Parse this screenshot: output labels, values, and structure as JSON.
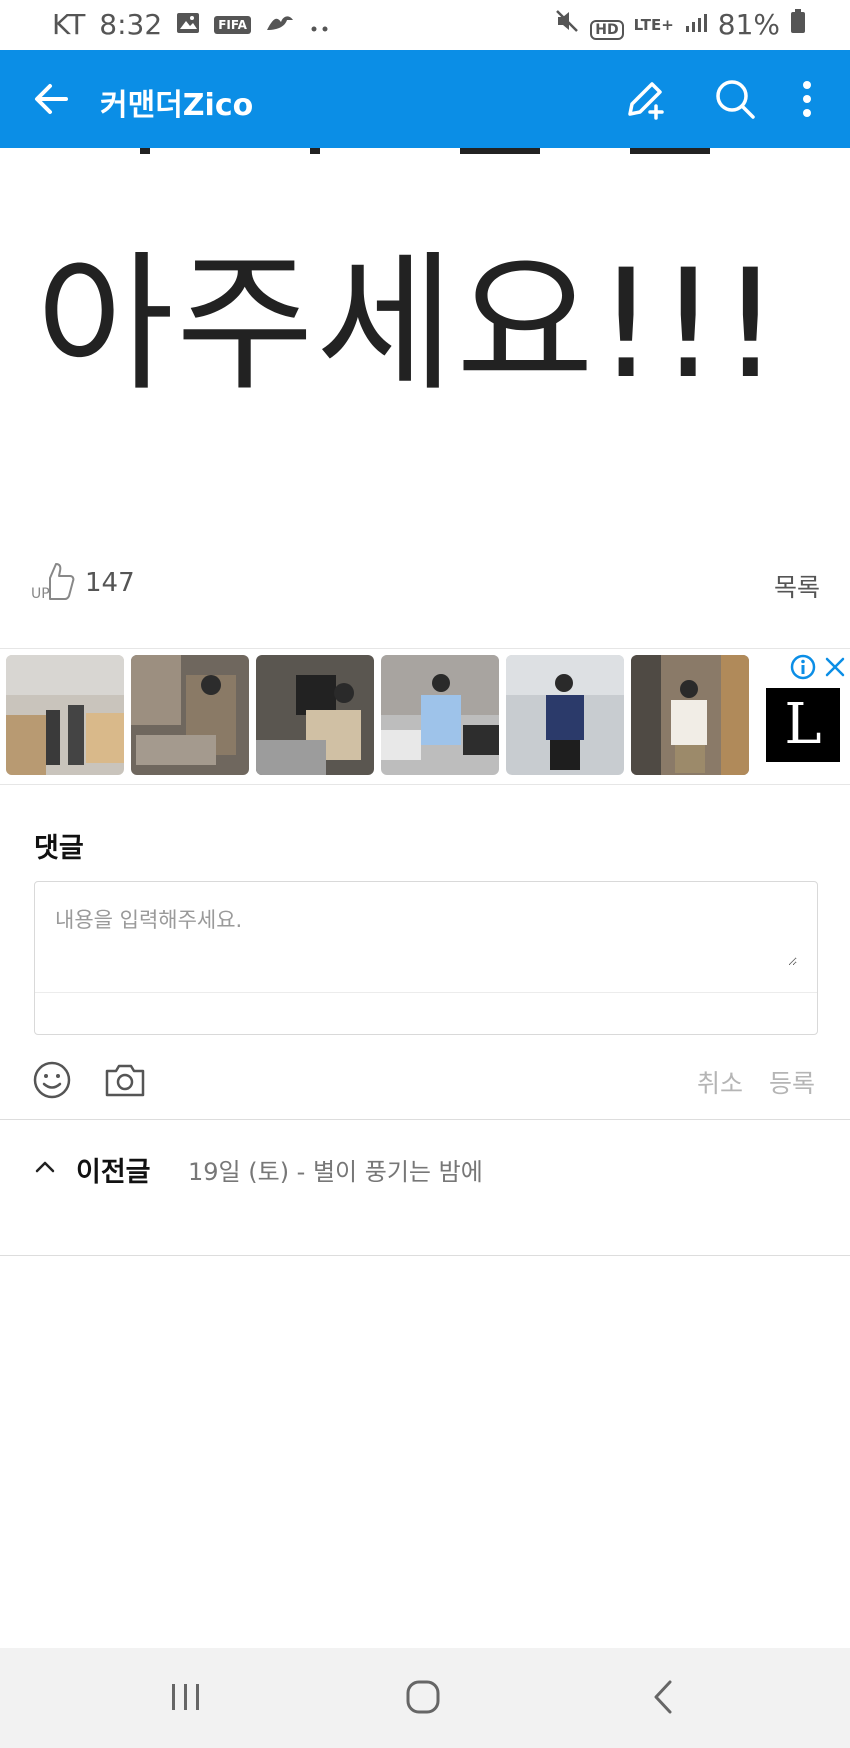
{
  "status_bar": {
    "carrier": "KT",
    "time": "8:32",
    "fifa_badge": "FIFA",
    "network": "LTE+",
    "hd_badge": "HD",
    "battery": "81%",
    "icons": [
      "gallery-icon",
      "fifa-icon",
      "game-icon",
      "more-dots-icon",
      "mute-icon",
      "hd-voice-icon",
      "lte-icon",
      "signal-icon",
      "battery-icon"
    ]
  },
  "app_bar": {
    "title": "커맨더Zico",
    "back_icon": "arrow-left-icon",
    "actions": [
      "write-icon",
      "search-icon",
      "more-vert-icon"
    ],
    "color": "#0b8ee6"
  },
  "article": {
    "big_text": "아주세요!!!"
  },
  "like": {
    "icon": "thumbs-up-icon",
    "count": "147",
    "list_label": "목록"
  },
  "ad": {
    "logo_text": "L",
    "icons": [
      "ad-info-icon",
      "ad-close-icon"
    ],
    "thumbnail_count": 6
  },
  "comments": {
    "title": "댓글",
    "placeholder": "내용을 입력해주세요.",
    "cancel_label": "취소",
    "submit_label": "등록",
    "tool_icons": [
      "emoji-icon",
      "camera-icon"
    ]
  },
  "previous_post": {
    "label": "이전글",
    "title": "19일 (토) - 별이 풍기는 밤에"
  },
  "nav_bar": {
    "buttons": [
      "recents-icon",
      "home-icon",
      "back-icon"
    ],
    "color": "#f2f2f2"
  }
}
